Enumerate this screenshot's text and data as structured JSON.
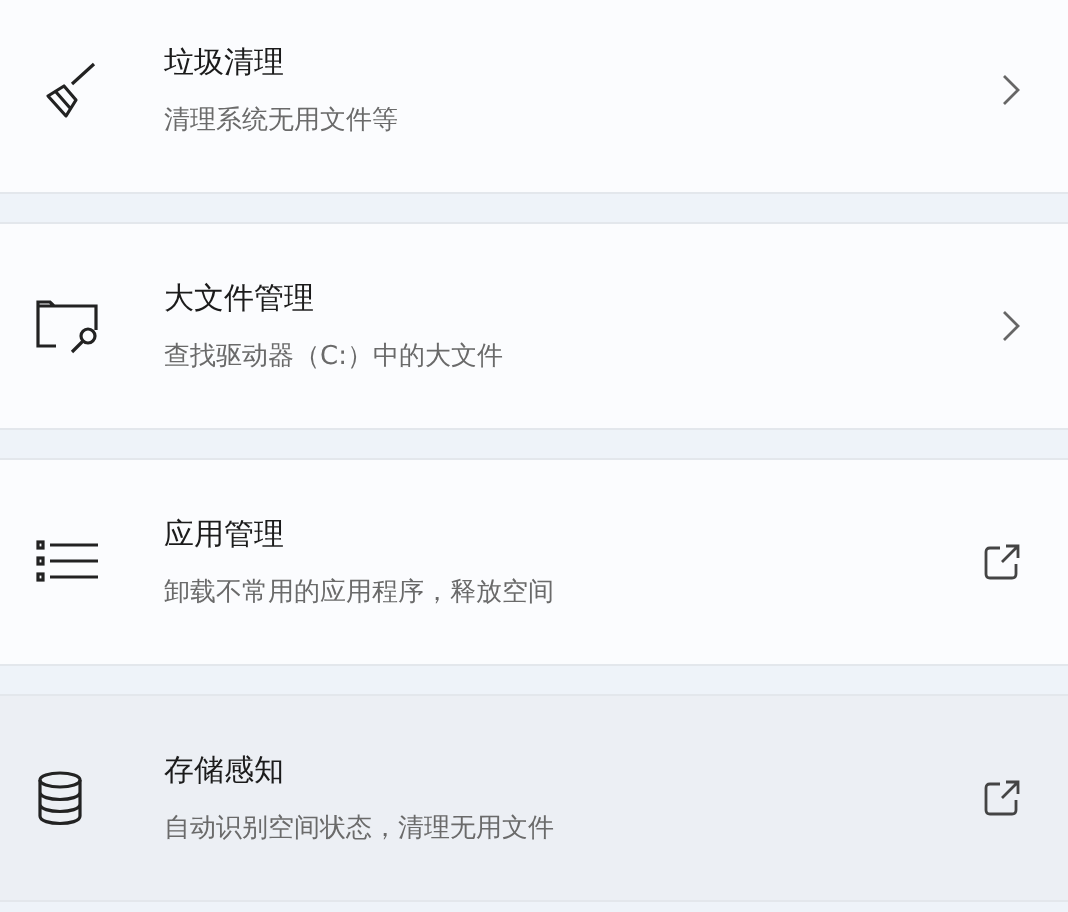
{
  "items": [
    {
      "title": "垃圾清理",
      "subtitle": "清理系统无用文件等",
      "kind": "navigate",
      "hovered": false
    },
    {
      "title": "大文件管理",
      "subtitle": "查找驱动器（C:）中的大文件",
      "kind": "navigate",
      "hovered": false
    },
    {
      "title": "应用管理",
      "subtitle": "卸载不常用的应用程序，释放空间",
      "kind": "external",
      "hovered": false
    },
    {
      "title": "存储感知",
      "subtitle": "自动识别空间状态，清理无用文件",
      "kind": "external",
      "hovered": true
    }
  ]
}
